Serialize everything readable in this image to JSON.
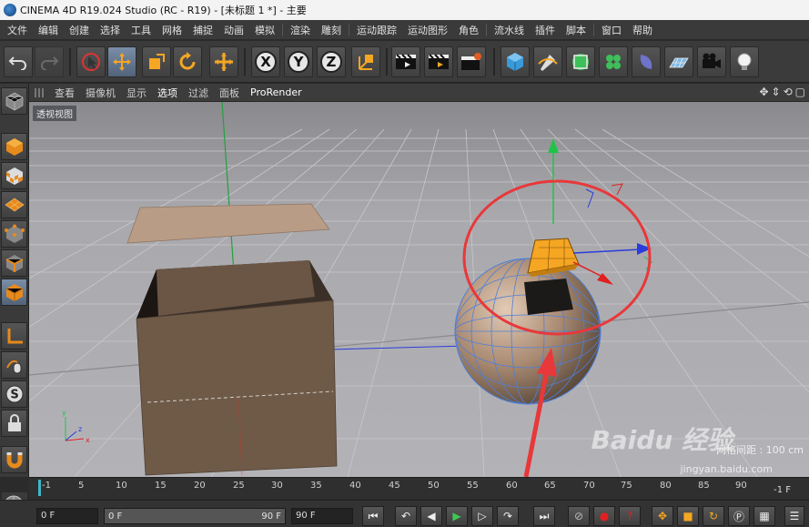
{
  "window": {
    "title": "CINEMA 4D R19.024 Studio (RC - R19) - [未标题 1 *] - 主要"
  },
  "menu": {
    "items": [
      "文件",
      "编辑",
      "创建",
      "选择",
      "工具",
      "网格",
      "捕捉",
      "动画",
      "模拟",
      "渲染",
      "雕刻",
      "运动跟踪",
      "运动图形",
      "角色",
      "流水线",
      "插件",
      "脚本",
      "窗口",
      "帮助"
    ]
  },
  "toolbar": {
    "undo": "undo-icon",
    "redo": "redo-icon",
    "axis_labels": {
      "x": "X",
      "y": "Y",
      "z": "Z"
    },
    "tools": [
      "live-selection-icon",
      "move-icon",
      "scale-icon",
      "rotate-icon",
      "recent-tool-icon",
      "coordinate-system-icon",
      "render-view-icon",
      "render-to-picture-viewer-icon",
      "edit-render-settings-icon",
      "cube-icon",
      "pen-icon",
      "subdivision-icon",
      "cloner-icon",
      "deformer-icon",
      "floor-icon",
      "camera-icon",
      "light-icon"
    ]
  },
  "viewport_menu": {
    "items": [
      "查看",
      "摄像机",
      "显示",
      "选项",
      "过滤",
      "面板",
      "ProRender"
    ]
  },
  "viewport": {
    "label": "透视视图",
    "grid_spacing_label": "网格间距 : 100 cm",
    "watermark_main": "Baidu 经验",
    "watermark_sub": "jingyan.baidu.com"
  },
  "timeline": {
    "ticks": [
      "-1",
      "5",
      "10",
      "15",
      "20",
      "25",
      "30",
      "35",
      "40",
      "45",
      "50",
      "55",
      "60",
      "65",
      "70",
      "75",
      "80",
      "85",
      "90"
    ],
    "current_frame_label": "-1 F"
  },
  "transport": {
    "start_field": "0 F",
    "range_start": "0 F",
    "range_end": "90 F",
    "end_field": "90 F"
  },
  "colors": {
    "accent_orange": "#f5a623",
    "highlight_circle": "#e8383a",
    "axis_green": "#22c24a",
    "axis_blue": "#2a3cdc",
    "axis_red": "#e02020",
    "box_brown": "#6f5a48",
    "sphere_copper": "#a98a72"
  }
}
